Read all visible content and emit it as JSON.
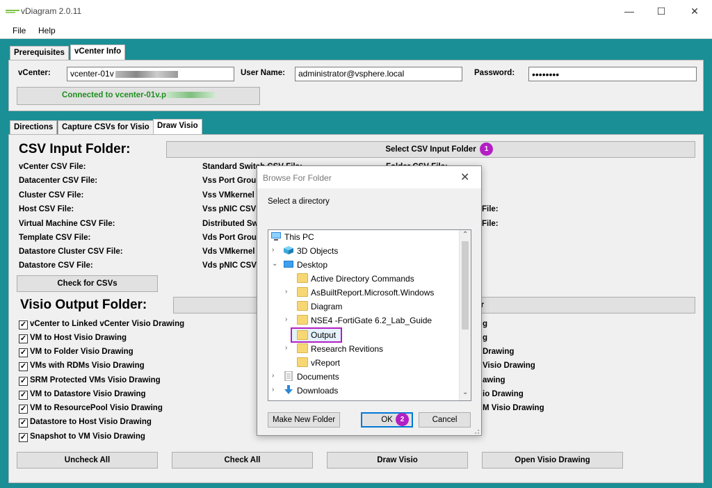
{
  "window": {
    "title": "vDiagram 2.0.11",
    "minimize": "—",
    "maximize": "☐",
    "close": "✕"
  },
  "menu": [
    "File",
    "Help"
  ],
  "top_tabs": [
    "Prerequisites",
    "vCenter Info"
  ],
  "vcenter": {
    "vcenter_label": "vCenter:",
    "vcenter_value": "vcenter-01v",
    "username_label": "User Name:",
    "username_value": "administrator@vsphere.local",
    "password_label": "Password:",
    "password_value": "••••••••",
    "status": "Connected to vcenter-01v.p"
  },
  "sub_tabs": [
    "Directions",
    "Capture CSVs for Visio",
    "Draw Visio"
  ],
  "csv_input": {
    "heading": "CSV Input Folder:",
    "select_button": "Select CSV Input Folder",
    "badge": "1",
    "col1": [
      "vCenter CSV File:",
      "Datacenter CSV File:",
      "Cluster CSV File:",
      "Host CSV File:",
      "Virtual Machine CSV File:",
      "Template CSV File:",
      "Datastore Cluster CSV File:",
      "Datastore CSV File:"
    ],
    "col2": [
      "Standard Switch CSV File:",
      "Vss Port Group",
      "Vss VMkernel",
      "Vss pNIC CSV",
      "Distributed Sw",
      "Vds Port Group",
      "Vds VMkernel",
      "Vds pNIC CSV"
    ],
    "col3_top": "Folder CSV File:",
    "col3_right": [
      "File:",
      "File:"
    ],
    "check_button": "Check for CSVs"
  },
  "visio_output": {
    "heading": "Visio Output Folder:",
    "button_suffix": "r",
    "checks": [
      "vCenter to Linked vCenter Visio Drawing",
      "VM to Host Visio Drawing",
      "VM to Folder Visio Drawing",
      "VMs with RDMs Visio Drawing",
      "SRM Protected VMs Visio Drawing",
      "VM to Datastore Visio Drawing",
      "VM to ResourcePool Visio Drawing",
      "Datastore to Host Visio Drawing",
      "Snapshot to VM Visio Drawing"
    ],
    "check_mark": "✓",
    "right_fragments": [
      "g",
      "g",
      "Drawing",
      "Visio Drawing",
      "awing",
      "io Drawing",
      "M Visio Drawing"
    ]
  },
  "bottom_buttons": [
    "Uncheck All",
    "Check All",
    "Draw Visio",
    "Open Visio Drawing"
  ],
  "dialog": {
    "title": "Browse For Folder",
    "close": "✕",
    "subtitle": "Select a directory",
    "tree": [
      {
        "label": "This PC",
        "icon": "pc-icon",
        "indent": 0,
        "arrow": ""
      },
      {
        "label": "3D Objects",
        "icon": "cube-icon",
        "indent": 1,
        "arrow": "›"
      },
      {
        "label": "Desktop",
        "icon": "desktop-icon",
        "indent": 1,
        "arrow": "⌄"
      },
      {
        "label": "Active Directory Commands",
        "icon": "folder-icon",
        "indent": 2,
        "arrow": ""
      },
      {
        "label": "AsBuiltReport.Microsoft.Windows",
        "icon": "folder-icon",
        "indent": 2,
        "arrow": "›"
      },
      {
        "label": "Diagram",
        "icon": "folder-icon",
        "indent": 2,
        "arrow": ""
      },
      {
        "label": "NSE4 -FortiGate 6.2_Lab_Guide",
        "icon": "folder-icon",
        "indent": 2,
        "arrow": "›"
      },
      {
        "label": "Output",
        "icon": "folder-icon",
        "indent": 2,
        "arrow": "",
        "selected": true
      },
      {
        "label": "Research Revitions",
        "icon": "folder-icon",
        "indent": 2,
        "arrow": "›"
      },
      {
        "label": "vReport",
        "icon": "folder-icon",
        "indent": 2,
        "arrow": ""
      },
      {
        "label": "Documents",
        "icon": "documents-icon",
        "indent": 1,
        "arrow": "›"
      },
      {
        "label": "Downloads",
        "icon": "downloads-icon",
        "indent": 1,
        "arrow": "›"
      }
    ],
    "scroll_up": "⌃",
    "scroll_down": "⌄",
    "make_new_folder": "Make New Folder",
    "ok": "OK",
    "ok_badge": "2",
    "cancel": "Cancel"
  },
  "colors": {
    "accent_teal": "#1a8f95",
    "highlight": "#b31fc4",
    "connected_text": "#1e8f1e"
  }
}
